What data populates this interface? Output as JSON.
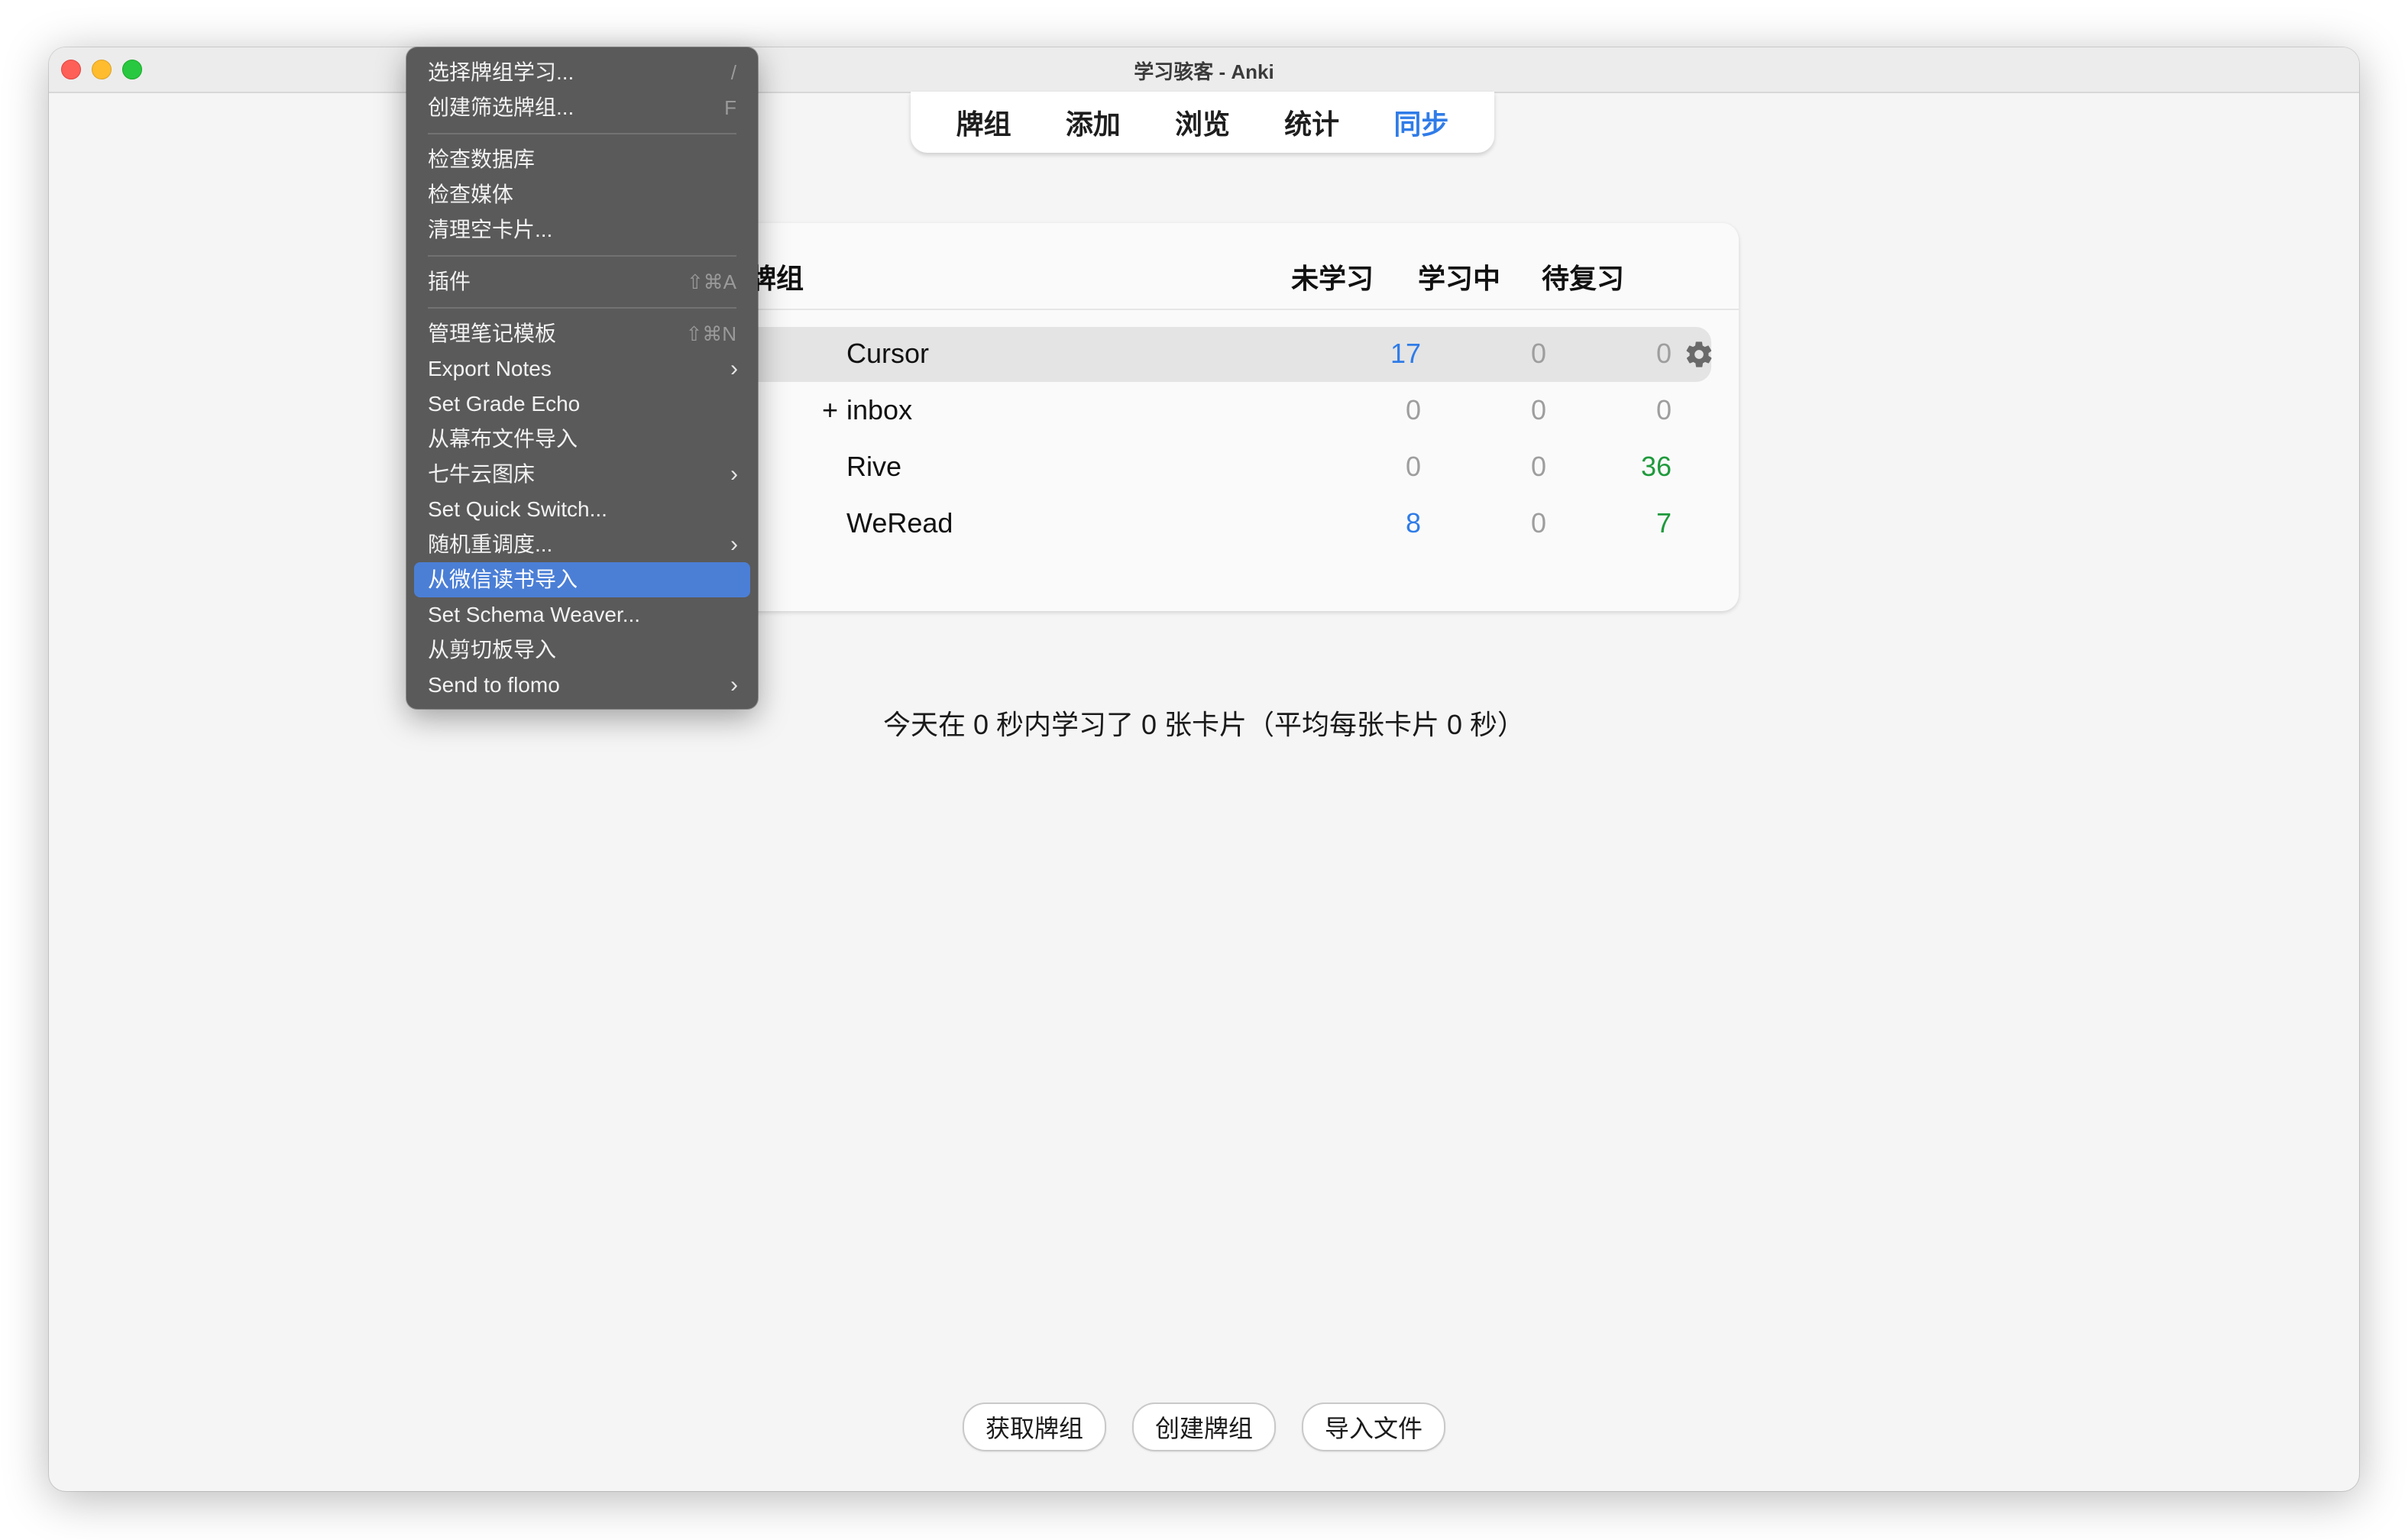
{
  "window": {
    "title": "学习骇客 - Anki"
  },
  "toolbar": {
    "items": [
      {
        "label": "牌组",
        "active": false
      },
      {
        "label": "添加",
        "active": false
      },
      {
        "label": "浏览",
        "active": false
      },
      {
        "label": "统计",
        "active": false
      },
      {
        "label": "同步",
        "active": true
      }
    ]
  },
  "deck_list": {
    "columns": {
      "deck": "牌组",
      "new": "未学习",
      "learning": "学习中",
      "due": "待复习"
    },
    "rows": [
      {
        "expander": "",
        "name": "Cursor",
        "new": "17",
        "learning": "0",
        "due": "0",
        "current": true
      },
      {
        "expander": "+",
        "name": "inbox",
        "new": "0",
        "learning": "0",
        "due": "0",
        "current": false
      },
      {
        "expander": "",
        "name": "Rive",
        "new": "0",
        "learning": "0",
        "due": "36",
        "current": false
      },
      {
        "expander": "",
        "name": "WeRead",
        "new": "8",
        "learning": "0",
        "due": "7",
        "current": false
      }
    ],
    "gear_icon": "gear-icon"
  },
  "stats": {
    "today": "今天在 0 秒内学习了 0 张卡片（平均每张卡片 0 秒）"
  },
  "bottom_buttons": {
    "get_shared": "获取牌组",
    "create_deck": "创建牌组",
    "import_file": "导入文件"
  },
  "tools_menu": {
    "groups": [
      [
        {
          "label": "选择牌组学习...",
          "shortcut": "/",
          "submenu": false
        },
        {
          "label": "创建筛选牌组...",
          "shortcut": "F",
          "submenu": false
        }
      ],
      [
        {
          "label": "检查数据库",
          "shortcut": "",
          "submenu": false
        },
        {
          "label": "检查媒体",
          "shortcut": "",
          "submenu": false
        },
        {
          "label": "清理空卡片...",
          "shortcut": "",
          "submenu": false
        }
      ],
      [
        {
          "label": "插件",
          "shortcut": "⇧⌘A",
          "submenu": false
        }
      ],
      [
        {
          "label": "管理笔记模板",
          "shortcut": "⇧⌘N",
          "submenu": false
        },
        {
          "label": "Export Notes",
          "shortcut": "",
          "submenu": true
        },
        {
          "label": "Set Grade Echo",
          "shortcut": "",
          "submenu": false
        },
        {
          "label": "从幕布文件导入",
          "shortcut": "",
          "submenu": false
        },
        {
          "label": "七牛云图床",
          "shortcut": "",
          "submenu": true
        },
        {
          "label": "Set Quick Switch...",
          "shortcut": "",
          "submenu": false
        },
        {
          "label": "随机重调度...",
          "shortcut": "",
          "submenu": true
        },
        {
          "label": "从微信读书导入",
          "shortcut": "",
          "submenu": false,
          "highlighted": true
        },
        {
          "label": "Set Schema Weaver...",
          "shortcut": "",
          "submenu": false
        },
        {
          "label": "从剪切板导入",
          "shortcut": "",
          "submenu": false
        },
        {
          "label": "Send to flomo",
          "shortcut": "",
          "submenu": true
        }
      ]
    ]
  },
  "colors": {
    "accent_blue": "#2f7ce8",
    "due_green": "#1f9a3c",
    "zero_gray": "#9e9e9e",
    "menu_bg": "#5a5a5a",
    "menu_highlight": "#4b7fd6"
  }
}
